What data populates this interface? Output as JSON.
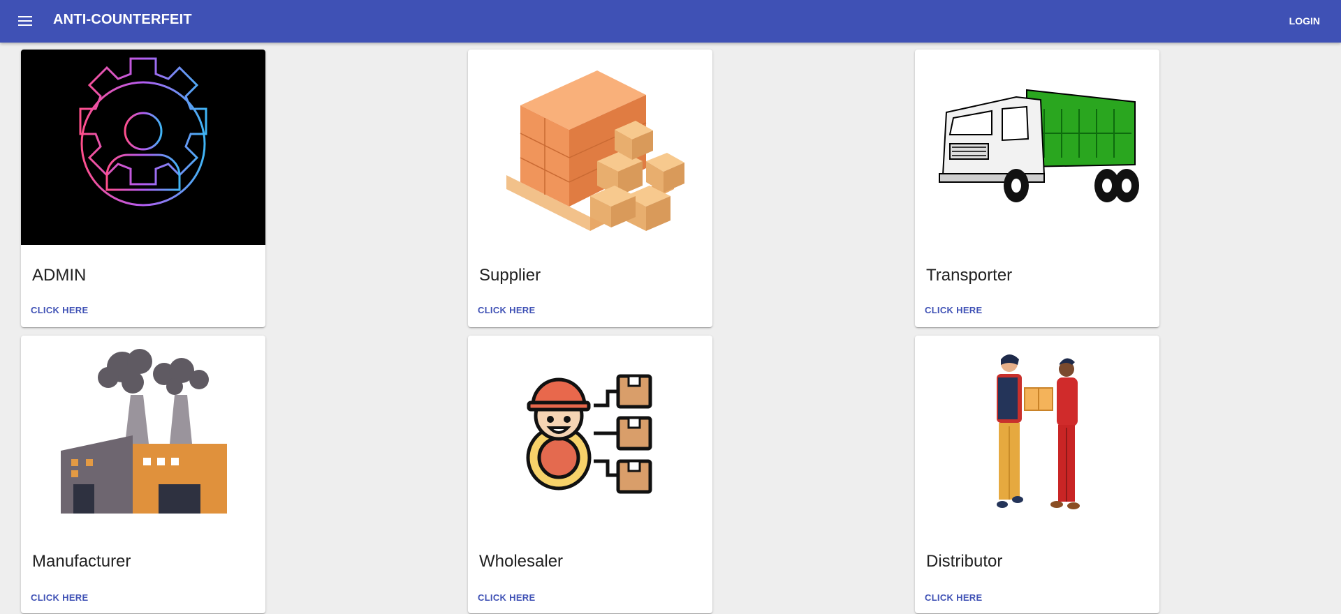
{
  "appbar": {
    "title": "ANTI-COUNTERFEIT",
    "login_label": "LOGIN",
    "background": "#3f51b5"
  },
  "cards": [
    {
      "title": "ADMIN",
      "action": "CLICK HERE",
      "image": "admin-gear-icon"
    },
    {
      "title": "Supplier",
      "action": "CLICK HERE",
      "image": "boxes-pallet-illustration"
    },
    {
      "title": "Transporter",
      "action": "CLICK HERE",
      "image": "dump-truck-illustration"
    },
    {
      "title": "Manufacturer",
      "action": "CLICK HERE",
      "image": "factory-illustration"
    },
    {
      "title": "Wholesaler",
      "action": "CLICK HERE",
      "image": "worker-boxes-icon"
    },
    {
      "title": "Distributor",
      "action": "CLICK HERE",
      "image": "handover-illustration"
    }
  ],
  "accent": "#3f51b5"
}
